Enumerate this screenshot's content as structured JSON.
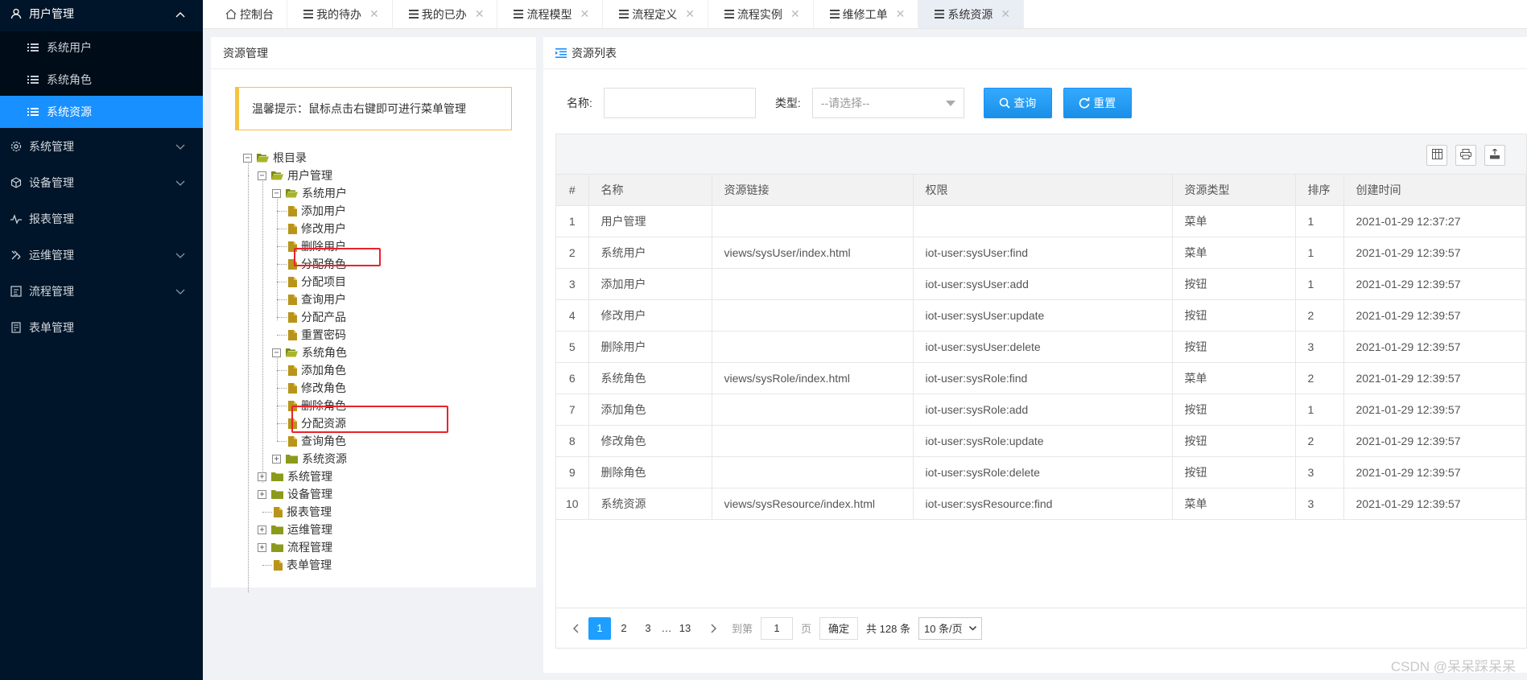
{
  "sidebar": {
    "items": [
      {
        "label": "用户管理",
        "icon": "user-icon",
        "open": true
      },
      {
        "label": "系统管理",
        "icon": "gear-icon"
      },
      {
        "label": "设备管理",
        "icon": "cube-icon"
      },
      {
        "label": "报表管理",
        "icon": "pulse-icon"
      },
      {
        "label": "运维管理",
        "icon": "tools-icon"
      },
      {
        "label": "流程管理",
        "icon": "flow-icon"
      },
      {
        "label": "表单管理",
        "icon": "form-icon"
      }
    ],
    "sub_items": [
      {
        "label": "系统用户"
      },
      {
        "label": "系统角色"
      },
      {
        "label": "系统资源",
        "active": true
      }
    ]
  },
  "tabs": [
    {
      "label": "控制台",
      "icon": "home-icon"
    },
    {
      "label": "我的待办",
      "icon": "list-icon"
    },
    {
      "label": "我的已办",
      "icon": "list-icon"
    },
    {
      "label": "流程模型",
      "icon": "list-icon"
    },
    {
      "label": "流程定义",
      "icon": "list-icon"
    },
    {
      "label": "流程实例",
      "icon": "list-icon"
    },
    {
      "label": "维修工单",
      "icon": "list-icon"
    },
    {
      "label": "系统资源",
      "icon": "list-icon",
      "active": true
    }
  ],
  "left_panel": {
    "title": "资源管理",
    "tip": "温馨提示：鼠标点击右键即可进行菜单管理",
    "tree": [
      {
        "label": "根目录"
      },
      {
        "label": "用户管理"
      },
      {
        "label": "系统用户"
      },
      {
        "label": "添加用户"
      },
      {
        "label": "修改用户"
      },
      {
        "label": "删除用户"
      },
      {
        "label": "分配角色"
      },
      {
        "label": "分配项目"
      },
      {
        "label": "查询用户"
      },
      {
        "label": "分配产品"
      },
      {
        "label": "重置密码"
      },
      {
        "label": "系统角色"
      },
      {
        "label": "添加角色"
      },
      {
        "label": "修改角色"
      },
      {
        "label": "删除角色"
      },
      {
        "label": "分配资源"
      },
      {
        "label": "查询角色"
      },
      {
        "label": "系统资源"
      },
      {
        "label": "系统管理"
      },
      {
        "label": "设备管理"
      },
      {
        "label": "报表管理"
      },
      {
        "label": "运维管理"
      },
      {
        "label": "流程管理"
      },
      {
        "label": "表单管理"
      }
    ]
  },
  "right_panel": {
    "title": "资源列表",
    "search": {
      "name_label": "名称:",
      "name_value": "",
      "type_label": "类型:",
      "type_placeholder": "--请选择--",
      "query_label": "查询",
      "reset_label": "重置"
    },
    "table": {
      "columns": [
        "#",
        "名称",
        "资源链接",
        "权限",
        "资源类型",
        "排序",
        "创建时间"
      ],
      "rows": [
        [
          "1",
          "用户管理",
          "",
          "",
          "菜单",
          "1",
          "2021-01-29 12:37:27"
        ],
        [
          "2",
          "系统用户",
          "views/sysUser/index.html",
          "iot-user:sysUser:find",
          "菜单",
          "1",
          "2021-01-29 12:39:57"
        ],
        [
          "3",
          "添加用户",
          "",
          "iot-user:sysUser:add",
          "按钮",
          "1",
          "2021-01-29 12:39:57"
        ],
        [
          "4",
          "修改用户",
          "",
          "iot-user:sysUser:update",
          "按钮",
          "2",
          "2021-01-29 12:39:57"
        ],
        [
          "5",
          "删除用户",
          "",
          "iot-user:sysUser:delete",
          "按钮",
          "3",
          "2021-01-29 12:39:57"
        ],
        [
          "6",
          "系统角色",
          "views/sysRole/index.html",
          "iot-user:sysRole:find",
          "菜单",
          "2",
          "2021-01-29 12:39:57"
        ],
        [
          "7",
          "添加角色",
          "",
          "iot-user:sysRole:add",
          "按钮",
          "1",
          "2021-01-29 12:39:57"
        ],
        [
          "8",
          "修改角色",
          "",
          "iot-user:sysRole:update",
          "按钮",
          "2",
          "2021-01-29 12:39:57"
        ],
        [
          "9",
          "删除角色",
          "",
          "iot-user:sysRole:delete",
          "按钮",
          "3",
          "2021-01-29 12:39:57"
        ],
        [
          "10",
          "系统资源",
          "views/sysResource/index.html",
          "iot-user:sysResource:find",
          "菜单",
          "3",
          "2021-01-29 12:39:57"
        ]
      ]
    },
    "pager": {
      "pages": [
        "1",
        "2",
        "3",
        "…",
        "13"
      ],
      "goto_label": "到第",
      "goto_value": "1",
      "page_unit": "页",
      "confirm_label": "确定",
      "total_text": "共 128 条",
      "page_size": "10 条/页"
    }
  },
  "watermark": "CSDN @呆呆踩呆呆",
  "colors": {
    "sidebar_bg": "#001529",
    "accent": "#1890ff",
    "tip_border": "#f5c242",
    "highlight_box": "#e8232b",
    "folder": "#8c9a1c",
    "file": "#b8941a"
  }
}
